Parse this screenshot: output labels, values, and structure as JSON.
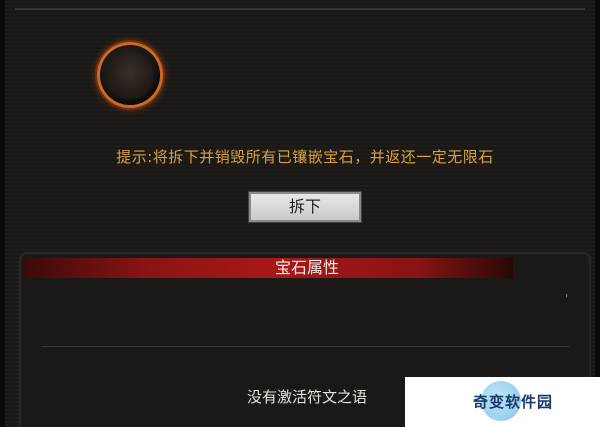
{
  "gem_socket": {
    "state": "empty"
  },
  "hint_text": "提示:将拆下并销毁所有已镶嵌宝石，并返还一定无限石",
  "remove_button_label": "拆下",
  "gem_attributes": {
    "title": "宝石属性",
    "marker": "'",
    "empty_text": "没有激活符文之语"
  },
  "watermark": {
    "text": "奇变软件园"
  },
  "colors": {
    "hint": "#d8a23a",
    "header": "#a81818",
    "socket_ring": "#c86a2a"
  }
}
